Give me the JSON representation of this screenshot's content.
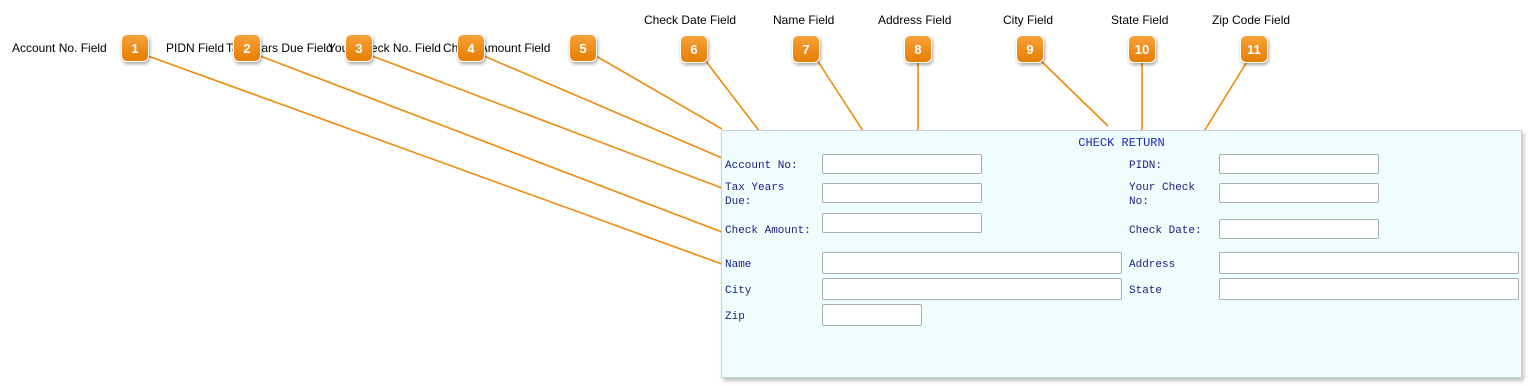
{
  "callouts": {
    "account_no_field": "Account No. Field",
    "pidn_field": "PIDN Field",
    "tax_years_due_field": "Tax Years Due Field",
    "your_check_no_field": "Your Check No. Field",
    "check_amount_field": "Check Amount Field",
    "check_date_field": "Check Date Field",
    "name_field": "Name Field",
    "address_field": "Address Field",
    "city_field": "City Field",
    "state_field": "State Field",
    "zip_code_field": "Zip Code Field"
  },
  "badges": [
    "1",
    "2",
    "3",
    "4",
    "5",
    "6",
    "7",
    "8",
    "9",
    "10",
    "11"
  ],
  "form": {
    "title": "CHECK RETURN",
    "account_no_label": "Account No:",
    "tax_years_due_label": "Tax Years Due:",
    "check_amount_label": "Check Amount:",
    "pidn_label": "PIDN:",
    "your_check_no_label": "Your Check No:",
    "check_date_label": "Check Date:",
    "name_label": "Name",
    "address_label": "Address",
    "city_label": "City",
    "state_label": "State",
    "zip_label": "Zip",
    "account_no_value": "",
    "tax_years_due_value": "",
    "check_amount_value": "",
    "pidn_value": "",
    "your_check_no_value": "",
    "check_date_value": "",
    "name_value": "",
    "address_value": "",
    "city_value": "",
    "state_value": "",
    "zip_value": ""
  },
  "colors": {
    "badge": "#f08a0c",
    "connector": "#f08a0c",
    "form_background": "#effdfd",
    "form_title": "#1a2bb5",
    "form_label": "#1a2380"
  }
}
